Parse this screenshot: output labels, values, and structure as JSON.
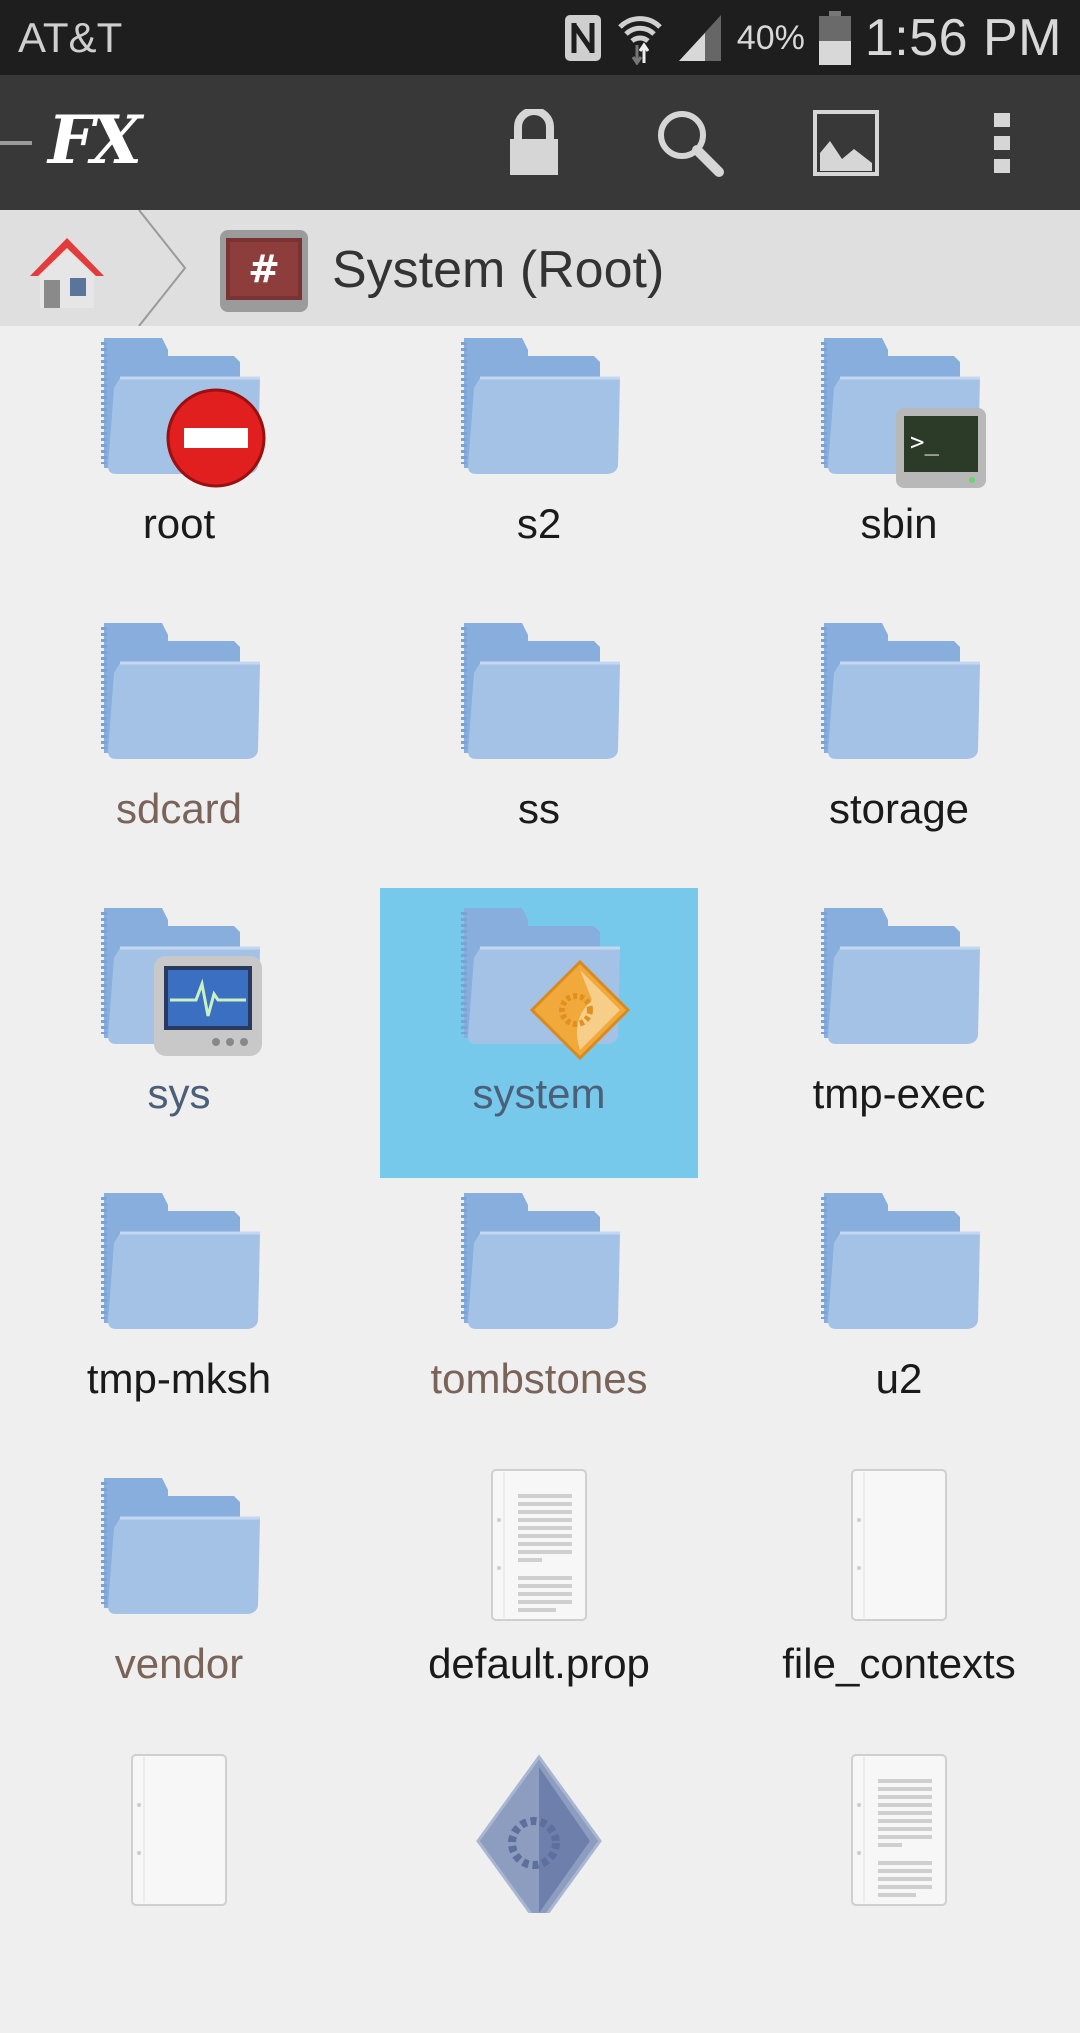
{
  "status_bar": {
    "carrier": "AT&T",
    "battery_percent": "40%",
    "battery_level": 0.4,
    "time": "1:56 PM",
    "icons": [
      "nfc-icon",
      "wifi-icon",
      "signal-icon",
      "battery-icon"
    ]
  },
  "toolbar": {
    "logo": "FX",
    "actions": [
      "lock-icon",
      "search-icon",
      "image-icon",
      "overflow-menu-icon"
    ]
  },
  "breadcrumb": {
    "home_icon": "home-icon",
    "current_icon": "root-hash-icon",
    "current_label": "System (Root)",
    "root_glyph": "#"
  },
  "colors": {
    "selected_bg": "#76c9ea",
    "folder_blue": "#9dbfe3",
    "label_brown": "#7a6358",
    "label_slate": "#4b6078"
  },
  "items": [
    {
      "name": "root",
      "type": "folder",
      "badge": "no-entry",
      "label_color": "default"
    },
    {
      "name": "s2",
      "type": "folder",
      "badge": "",
      "label_color": "default"
    },
    {
      "name": "sbin",
      "type": "folder",
      "badge": "terminal",
      "label_color": "default"
    },
    {
      "name": "sdcard",
      "type": "folder",
      "badge": "",
      "label_color": "brown"
    },
    {
      "name": "ss",
      "type": "folder",
      "badge": "",
      "label_color": "default"
    },
    {
      "name": "storage",
      "type": "folder",
      "badge": "",
      "label_color": "default"
    },
    {
      "name": "sys",
      "type": "folder",
      "badge": "monitor",
      "label_color": "slate"
    },
    {
      "name": "system",
      "type": "folder",
      "badge": "gear-diamond",
      "label_color": "slate",
      "selected": true
    },
    {
      "name": "tmp-exec",
      "type": "folder",
      "badge": "",
      "label_color": "default"
    },
    {
      "name": "tmp-mksh",
      "type": "folder",
      "badge": "",
      "label_color": "default"
    },
    {
      "name": "tombstones",
      "type": "folder",
      "badge": "",
      "label_color": "brown"
    },
    {
      "name": "u2",
      "type": "folder",
      "badge": "",
      "label_color": "default"
    },
    {
      "name": "vendor",
      "type": "folder",
      "badge": "",
      "label_color": "brown"
    },
    {
      "name": "default.prop",
      "type": "text-file",
      "badge": "",
      "label_color": "default"
    },
    {
      "name": "file_contexts",
      "type": "blank-file",
      "badge": "",
      "label_color": "default"
    },
    {
      "name": "",
      "type": "blank-file",
      "badge": "",
      "label_color": "default"
    },
    {
      "name": "",
      "type": "executable",
      "badge": "",
      "label_color": "default"
    },
    {
      "name": "",
      "type": "text-file",
      "badge": "",
      "label_color": "default"
    }
  ]
}
